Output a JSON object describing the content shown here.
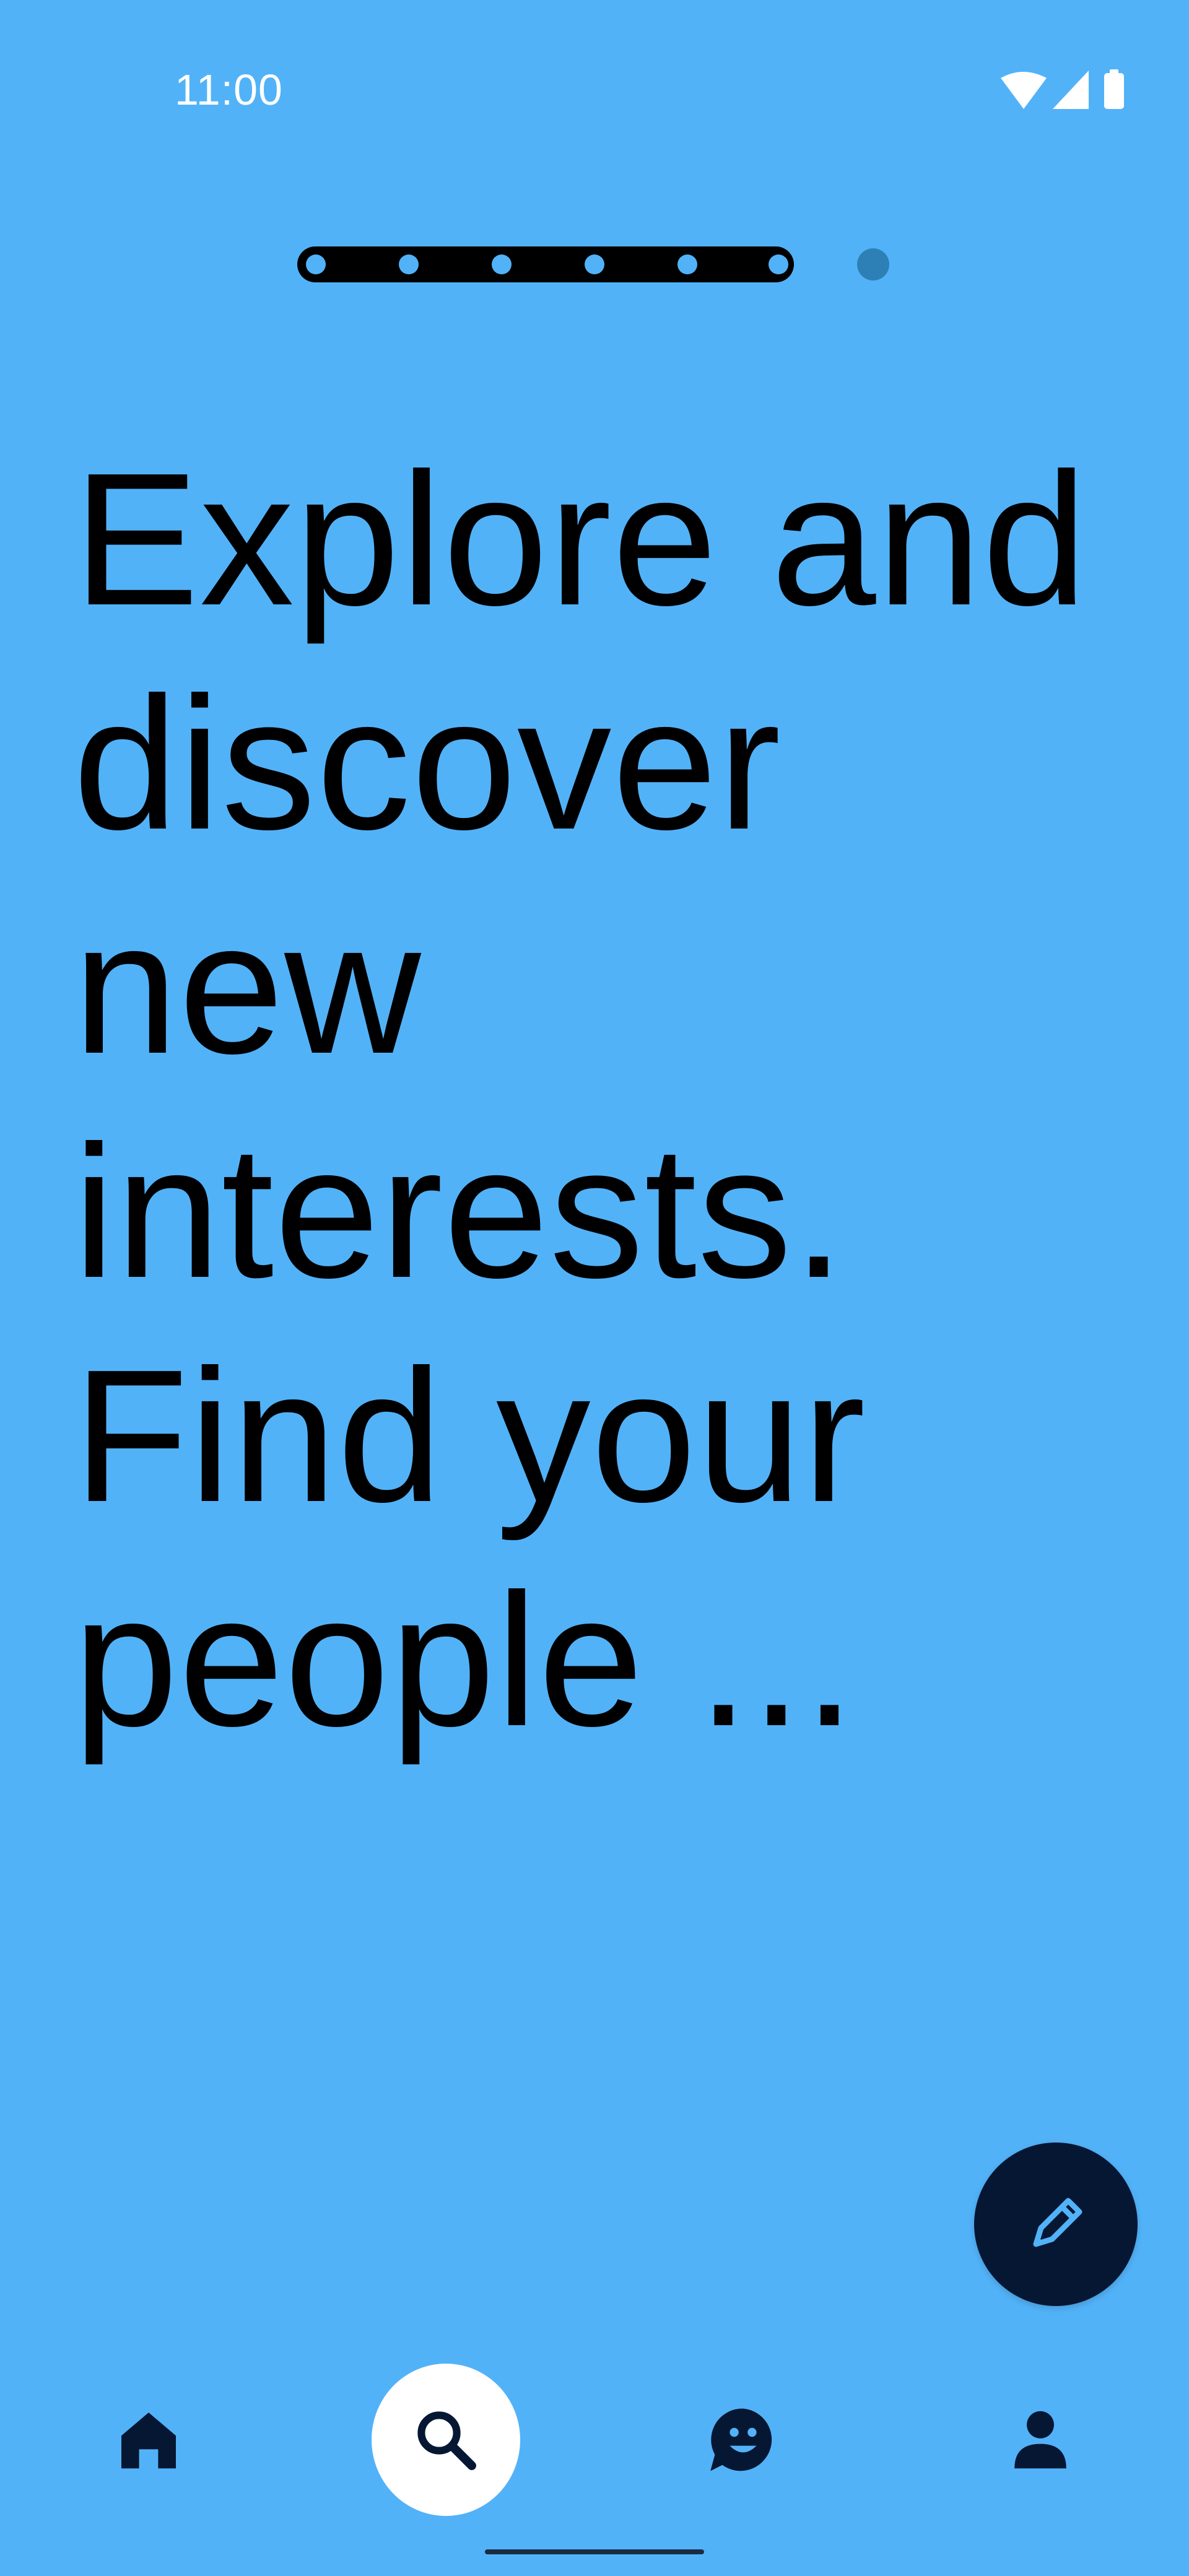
{
  "status_bar": {
    "time": "11:00",
    "icons": [
      "wifi-icon",
      "cellular-signal-icon",
      "battery-icon"
    ]
  },
  "pager": {
    "page_count": 7,
    "current_page": 6
  },
  "headline": "Explore and\ndiscover\nnew\ninterests.\nFind your\npeople ...",
  "fab": {
    "icon": "pencil-icon"
  },
  "bottom_nav": {
    "items": [
      {
        "icon": "home-icon",
        "active": false
      },
      {
        "icon": "search-icon",
        "active": true
      },
      {
        "icon": "chat-smile-icon",
        "active": false
      },
      {
        "icon": "person-icon",
        "active": false
      }
    ]
  },
  "colors": {
    "background": "#52b2f8",
    "navy": "#061733",
    "white": "#ffffff",
    "pager_inactive_dot": "#2d80b6"
  }
}
